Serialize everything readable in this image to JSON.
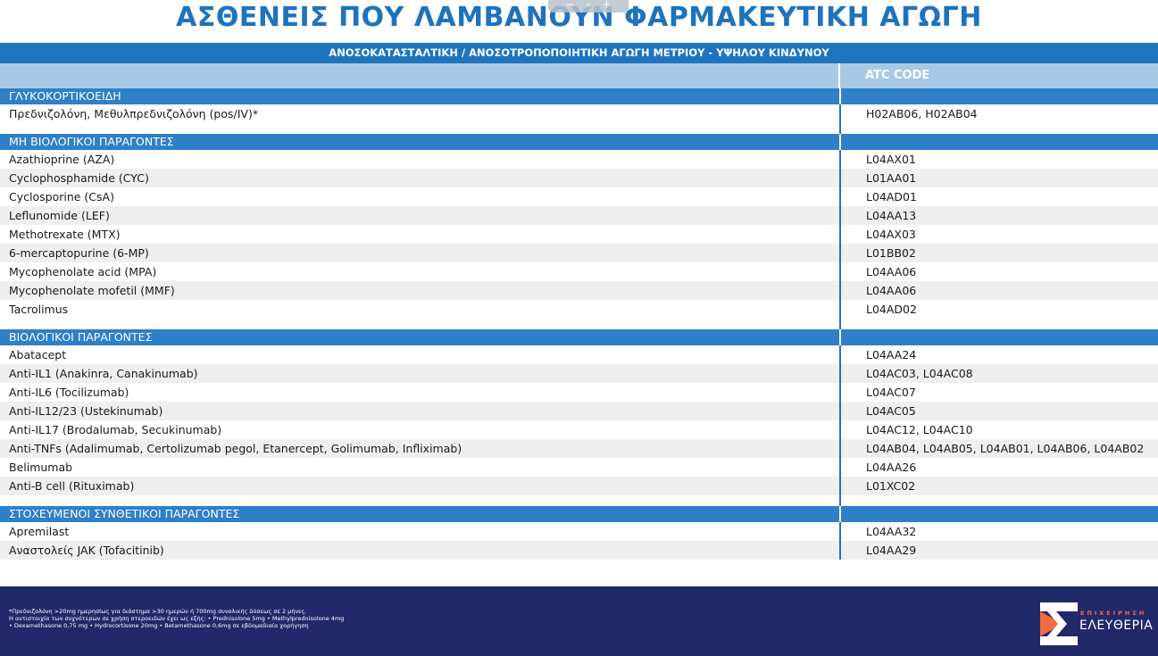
{
  "title": "ΑΣΘΕΝΕΙΣ ΠΟΥ ΛΑΜΒΑΝΟΥΝ ΦΑΡΜΑΚΕΥΤΙΚΗ ΑΓΩΓΗ",
  "zoom": {
    "minus": "−",
    "magnifier": "⌕",
    "plus": "+"
  },
  "table_header": "ΑΝΟΣΟΚΑΤΑΣΤΑΛΤΙΚΗ / ΑΝΟΣΟΤΡΟΠΟΠΟΙΗΤΙΚΗ ΑΓΩΓΗ ΜΕΤΡΙΟΥ - ΥΨΗΛΟΥ ΚΙΝΔΥΝΟΥ",
  "atc_header": "ATC CODE",
  "sections": [
    {
      "name": "ΓΛΥΚΟΚΟΡΤΙΚΟΕΙΔΗ",
      "rows": [
        {
          "drug": "Πρεδνιζολόνη, Μεθυλπρεδνιζολόνη (pos/IV)*",
          "atc": "H02AB06, H02AB04"
        }
      ]
    },
    {
      "name": "ΜΗ ΒΙΟΛΟΓΙΚΟΙ ΠΑΡΑΓΟΝΤΕΣ",
      "rows": [
        {
          "drug": "Azathioprine (AZA)",
          "atc": "L04AX01"
        },
        {
          "drug": "Cyclophosphamide (CYC)",
          "atc": "L01AA01"
        },
        {
          "drug": "Cyclosporine (CsA)",
          "atc": "L04AD01"
        },
        {
          "drug": "Leflunomide (LEF)",
          "atc": "L04AA13"
        },
        {
          "drug": "Methotrexate (MTX)",
          "atc": "L04AX03"
        },
        {
          "drug": "6-mercaptopurine (6-MP)",
          "atc": "L01BB02"
        },
        {
          "drug": "Mycophenolate acid (MPA)",
          "atc": "L04AA06"
        },
        {
          "drug": "Mycophenolate mofetil (MMF)",
          "atc": "L04AA06"
        },
        {
          "drug": "Tacrolimus",
          "atc": "L04AD02"
        }
      ]
    },
    {
      "name": "ΒΙΟΛΟΓΙΚΟΙ ΠΑΡΑΓΟΝΤΕΣ",
      "rows": [
        {
          "drug": "Abatacept",
          "atc": "L04AA24"
        },
        {
          "drug": "Anti-IL1 (Anakinra, Canakinumab)",
          "atc": "L04AC03, L04AC08"
        },
        {
          "drug": "Anti-IL6 (Tocilizumab)",
          "atc": "L04AC07"
        },
        {
          "drug": "Anti-IL12/23 (Ustekinumab)",
          "atc": "L04AC05"
        },
        {
          "drug": "Anti-IL17 (Brodalumab, Secukinumab)",
          "atc": "L04AC12, L04AC10"
        },
        {
          "drug": "Anti-TNFs (Adalimumab, Certolizumab pegol, Etanercept, Golimumab, Infliximab)",
          "atc": "L04AB04, L04AB05, L04AB01, L04AB06, L04AB02"
        },
        {
          "drug": "Belimumab",
          "atc": "L04AA26"
        },
        {
          "drug": "Anti-B cell (Rituximab)",
          "atc": "L01XC02"
        }
      ]
    },
    {
      "name": "ΣΤΟΧΕΥΜΕΝΟΙ ΣΥΝΘΕΤΙΚΟΙ ΠΑΡΑΓΟΝΤΕΣ",
      "rows": [
        {
          "drug": "Apremilast",
          "atc": "L04AA32"
        },
        {
          "drug": "Αναστολείς JAK (Tofacitinib)",
          "atc": "L04AA29"
        }
      ]
    }
  ],
  "footnotes": [
    "*Πρεδνιζολόνη >20mg ημερησίως για διάστημα >30 ημερών ή 700mg συνολικής δόσεως σε 2 μήνες.",
    "Η αντιστοιχία των συχνότερων σε χρήση στεροειδών έχει ως εξής: • Prednisolone 5mg • Methylprednisolone 4mg",
    "• Dexamethasone 0,75 mg • Hydrocortisone 20mg • Betamethasone 0,6mg σε εβδομαδιαία χορήγηση"
  ],
  "logo": {
    "top": "ΕΠΙΧΕΙΡΗΣΗ",
    "main": "ΕΛΕΥΘΕΡΙΑ"
  },
  "colors": {
    "title": "#1e73be",
    "header": "#1f74c0",
    "section": "#2f7fc9",
    "atc_bar": "#a9c8e6",
    "footer": "#22296a",
    "logo_accent": "#f26a3d"
  }
}
